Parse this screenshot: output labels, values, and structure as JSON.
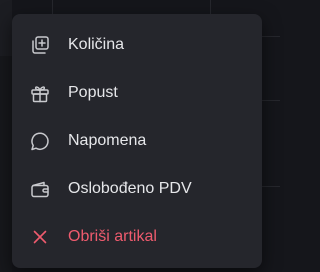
{
  "menu": {
    "items": [
      {
        "label": "Količina",
        "icon": "quantity-add-icon"
      },
      {
        "label": "Popust",
        "icon": "gift-icon"
      },
      {
        "label": "Napomena",
        "icon": "chat-bubble-icon"
      },
      {
        "label": "Oslobođeno PDV",
        "icon": "wallet-icon"
      },
      {
        "label": "Obriši artikal",
        "icon": "close-icon"
      }
    ]
  },
  "colors": {
    "menu_background": "#25262c",
    "text": "#e6e7ea",
    "icon": "#c8c9cd",
    "danger": "#ef5b6e"
  }
}
